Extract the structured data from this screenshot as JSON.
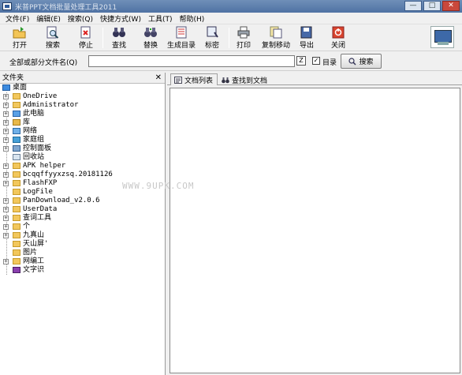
{
  "window": {
    "title": "米普PPT文档批量处理工具2011",
    "min": "—",
    "max": "□",
    "close": "✕"
  },
  "menu": [
    "文件(F)",
    "编辑(E)",
    "搜索(Q)",
    "快捷方式(W)",
    "工具(T)",
    "帮助(H)"
  ],
  "toolbar": {
    "open": "打开",
    "search": "搜索",
    "stop": "停止",
    "find": "查找",
    "replace": "替换",
    "gen_toc": "生成目录",
    "mark": "标密",
    "print": "打印",
    "copy_move": "复制移动",
    "export": "导出",
    "close": "关闭"
  },
  "searchbar": {
    "label": "全部或部分文件名(Q)",
    "value": "",
    "dir_checked": "✓",
    "dir_label": "目录",
    "button": "搜索",
    "picker_glyph": "Z"
  },
  "folder_panel": {
    "title": "文件夹",
    "close_glyph": "✕",
    "root": "桌面",
    "items": [
      {
        "label": "OneDrive",
        "expand": "+",
        "icon": "onedrive-icon"
      },
      {
        "label": "Administrator",
        "expand": "+",
        "icon": "user-icon"
      },
      {
        "label": "此电脑",
        "expand": "+",
        "icon": "computer-icon"
      },
      {
        "label": "库",
        "expand": "+",
        "icon": "library-icon"
      },
      {
        "label": "网络",
        "expand": "+",
        "icon": "network-icon"
      },
      {
        "label": "家庭组",
        "expand": "+",
        "icon": "homegroup-icon"
      },
      {
        "label": "控制面板",
        "expand": "+",
        "icon": "control-panel-icon"
      },
      {
        "label": "回收站",
        "expand": "",
        "icon": "recycle-bin-icon"
      },
      {
        "label": "APK helper",
        "expand": "+",
        "icon": "folder-icon"
      },
      {
        "label": "bcqqffyyxzsq.20181126",
        "expand": "+",
        "icon": "folder-icon"
      },
      {
        "label": "FlashFXP",
        "expand": "+",
        "icon": "folder-icon"
      },
      {
        "label": "LogFile",
        "expand": "",
        "icon": "folder-icon"
      },
      {
        "label": "PanDownload_v2.0.6",
        "expand": "+",
        "icon": "folder-icon"
      },
      {
        "label": "UserData",
        "expand": "+",
        "icon": "folder-icon"
      },
      {
        "label": "查词工具",
        "expand": "+",
        "icon": "folder-icon"
      },
      {
        "label": "个",
        "expand": "+",
        "icon": "folder-icon"
      },
      {
        "label": "九真山",
        "expand": "+",
        "icon": "folder-icon"
      },
      {
        "label": "天山屏'",
        "expand": "",
        "icon": "folder-icon"
      },
      {
        "label": "图片",
        "expand": "",
        "icon": "folder-icon"
      },
      {
        "label": "网编工",
        "expand": "+",
        "icon": "folder-icon"
      },
      {
        "label": "文字识",
        "expand": "",
        "icon": "winrar-icon"
      }
    ]
  },
  "tabs": {
    "doc_list": "文档列表",
    "found_docs": "查找到文档"
  },
  "watermark": "WWW.9UPK.COM"
}
